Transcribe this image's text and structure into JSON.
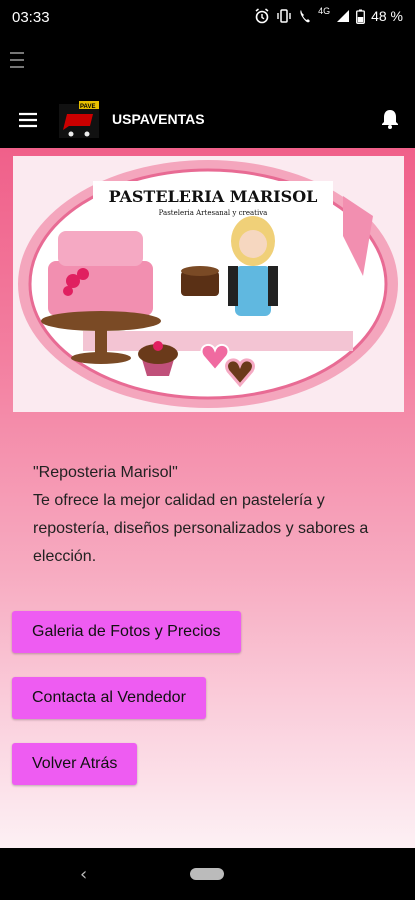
{
  "status_bar": {
    "time": "03:33",
    "network": "4G",
    "battery": "48 %"
  },
  "app_bar": {
    "title": "USPAVENTAS",
    "logo_text": "PAVE"
  },
  "banner": {
    "title": "PASTELERIA MARISOL",
    "subtitle": "Pasteleria Artesanal y creativa"
  },
  "description": {
    "line1": "\"Reposteria Marisol\"",
    "line2": "Te ofrece la mejor calidad en pastelería y repostería, diseños personalizados y sabores a elección."
  },
  "buttons": {
    "gallery": "Galeria de Fotos y Precios",
    "contact": "Contacta al Vendedor",
    "back": "Volver Atrás"
  },
  "nav_bar": {
    "back_glyph": "‹"
  },
  "colors": {
    "button": "#ee5cf2",
    "content_top": "#f0608a",
    "content_bottom": "#fdf0f4",
    "banner_pink": "#f4a6bd"
  }
}
